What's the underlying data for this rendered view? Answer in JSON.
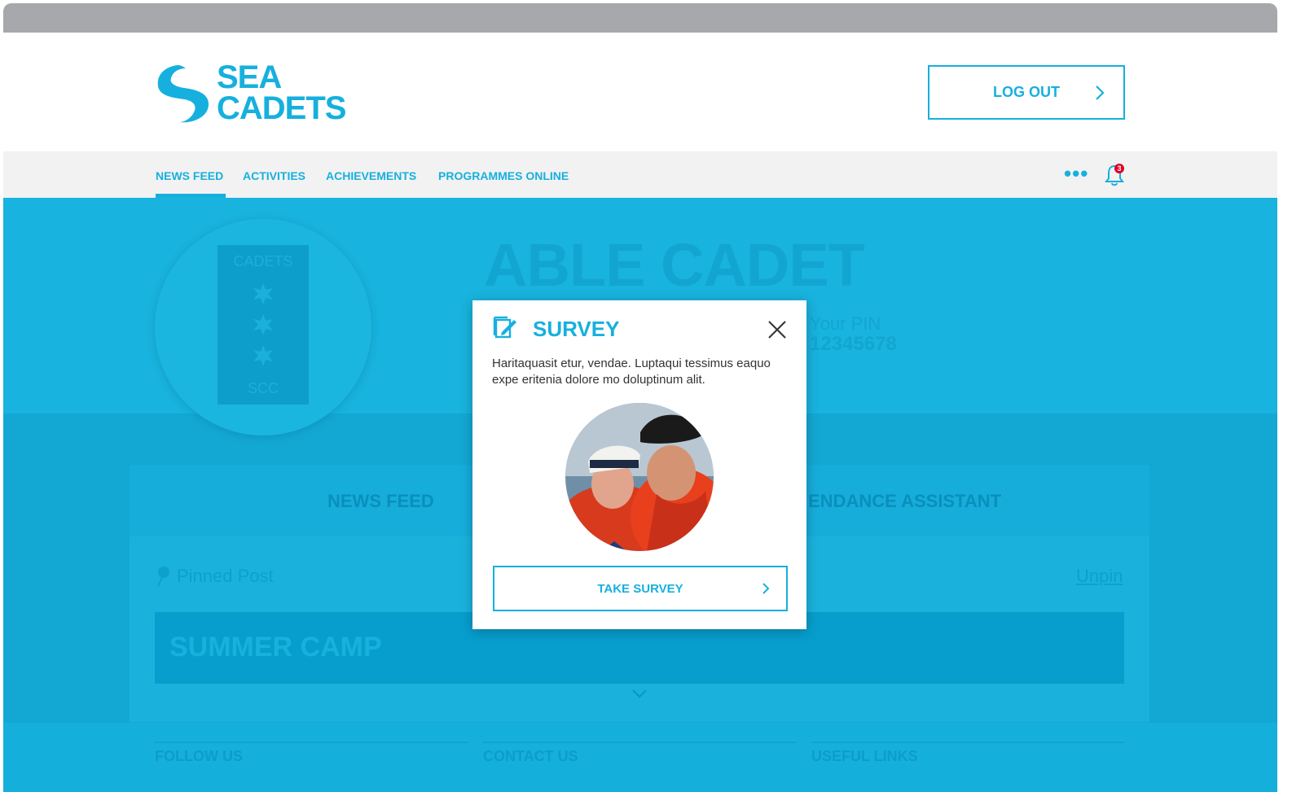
{
  "brand": {
    "line1": "SEA",
    "line2": "CADETS",
    "accent_color": "#16b0de"
  },
  "header": {
    "logout_label": "LOG OUT"
  },
  "nav": {
    "items": [
      "NEWS FEED",
      "ACTIVITIES",
      "ACHIEVEMENTS",
      "PROGRAMMES ONLINE"
    ],
    "active": "NEWS FEED",
    "more_icon": "ellipsis-icon",
    "notifications_icon": "bell-icon",
    "notification_count": "3"
  },
  "profile": {
    "rank_slide_top": "CADETS",
    "rank_slide_bottom": "SCC",
    "rank_name": "ABLE CADET",
    "pin_label": "Your PIN",
    "pin_value": "12345678"
  },
  "content": {
    "tab_news_feed": "NEWS FEED",
    "tab_attendance": "ENDANCE ASSISTANT",
    "pinned_label": "Pinned Post",
    "unpin_label": "Unpin",
    "post_title": "SUMMER CAMP"
  },
  "footer": {
    "follow_us": "FOLLOW US",
    "contact_us": "CONTACT US",
    "useful_links": "USEFUL  LINKS"
  },
  "modal": {
    "title": "SURVEY",
    "body": "Haritaquasit etur, vendae. Luptaqui tessimus eaquo expe eritenia dolore mo doluptinum alit.",
    "button_label": "TAKE SURVEY",
    "icon": "survey-edit-icon",
    "close_icon": "close-icon"
  }
}
